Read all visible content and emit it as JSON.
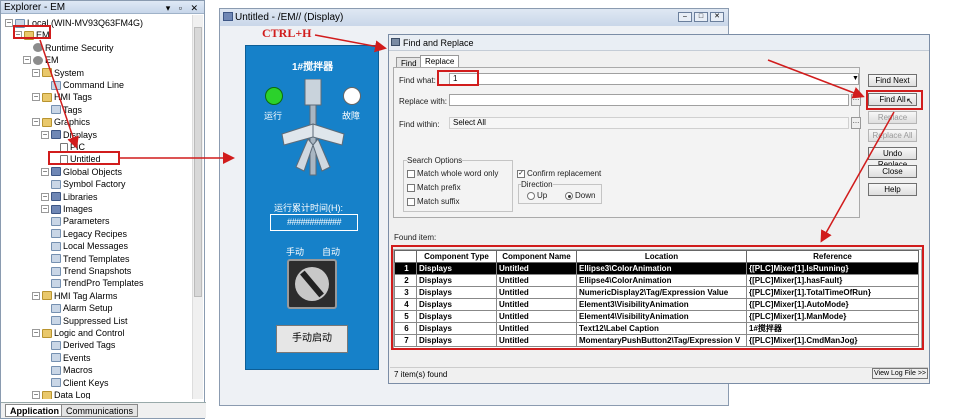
{
  "explorer": {
    "title": "Explorer - EM",
    "tree": [
      {
        "label": "Local (WIN-MV93Q63FM4G)",
        "indent": 0,
        "icon": "computer-icon"
      },
      {
        "label": "EM",
        "indent": 1,
        "icon": "folder-icon"
      },
      {
        "label": "Runtime Security",
        "indent": 2,
        "icon": "security-icon"
      },
      {
        "label": "EM",
        "indent": 2,
        "icon": "gear-icon"
      },
      {
        "label": "System",
        "indent": 3,
        "icon": "folder-icon"
      },
      {
        "label": "Command Line",
        "indent": 4,
        "icon": "component-icon"
      },
      {
        "label": "HMI Tags",
        "indent": 3,
        "icon": "folder-icon"
      },
      {
        "label": "Tags",
        "indent": 4,
        "icon": "component-icon"
      },
      {
        "label": "Graphics",
        "indent": 3,
        "icon": "folder-icon"
      },
      {
        "label": "Displays",
        "indent": 4,
        "icon": "display-icon"
      },
      {
        "label": "PIC",
        "indent": 5,
        "icon": "page-icon"
      },
      {
        "label": "Untitled",
        "indent": 5,
        "icon": "page-icon"
      },
      {
        "label": "Global Objects",
        "indent": 4,
        "icon": "display-icon"
      },
      {
        "label": "Symbol Factory",
        "indent": 4,
        "icon": "component-icon"
      },
      {
        "label": "Libraries",
        "indent": 4,
        "icon": "display-icon"
      },
      {
        "label": "Images",
        "indent": 4,
        "icon": "display-icon"
      },
      {
        "label": "Parameters",
        "indent": 4,
        "icon": "component-icon"
      },
      {
        "label": "Legacy Recipes",
        "indent": 4,
        "icon": "component-icon"
      },
      {
        "label": "Local Messages",
        "indent": 4,
        "icon": "component-icon"
      },
      {
        "label": "Trend Templates",
        "indent": 4,
        "icon": "component-icon"
      },
      {
        "label": "Trend Snapshots",
        "indent": 4,
        "icon": "component-icon"
      },
      {
        "label": "TrendPro Templates",
        "indent": 4,
        "icon": "component-icon"
      },
      {
        "label": "HMI Tag Alarms",
        "indent": 3,
        "icon": "folder-icon"
      },
      {
        "label": "Alarm Setup",
        "indent": 4,
        "icon": "component-icon"
      },
      {
        "label": "Suppressed List",
        "indent": 4,
        "icon": "component-icon"
      },
      {
        "label": "Logic and Control",
        "indent": 3,
        "icon": "folder-icon"
      },
      {
        "label": "Derived Tags",
        "indent": 4,
        "icon": "component-icon"
      },
      {
        "label": "Events",
        "indent": 4,
        "icon": "component-icon"
      },
      {
        "label": "Macros",
        "indent": 4,
        "icon": "component-icon"
      },
      {
        "label": "Client Keys",
        "indent": 4,
        "icon": "component-icon"
      },
      {
        "label": "Data Log",
        "indent": 3,
        "icon": "folder-icon"
      }
    ],
    "tabs": [
      "Application",
      "Communications"
    ]
  },
  "display_window": {
    "title": "Untitled - /EM// (Display)",
    "hmi": {
      "title": "1#搅拌器",
      "label_run": "运行",
      "label_fault": "故障",
      "runtime_label": "运行累计时间(H):",
      "runtime_value": "############",
      "label_manual": "手动",
      "label_auto": "自动",
      "start_button": "手动启动"
    }
  },
  "annotation": {
    "shortcut": "CTRL+H"
  },
  "find_replace": {
    "title": "Find and Replace",
    "tabs": [
      "Find",
      "Replace"
    ],
    "find_what_label": "Find what:",
    "find_what_value": "1",
    "replace_with_label": "Replace with:",
    "replace_with_value": "",
    "find_within_label": "Find within:",
    "find_within_value": "Select All",
    "search_options_label": "Search Options",
    "match_whole_word": "Match whole word only",
    "match_prefix": "Match prefix",
    "match_suffix": "Match suffix",
    "confirm_replacement": "Confirm replacement",
    "direction_label": "Direction",
    "dir_up": "Up",
    "dir_down": "Down",
    "buttons": {
      "find_next": "Find Next",
      "find_all": "Find All",
      "replace": "Replace",
      "replace_all": "Replace All",
      "undo_replace": "Undo Replace",
      "close": "Close",
      "help": "Help"
    },
    "found_items_label": "Found item:",
    "columns": [
      "",
      "Component Type",
      "Component  Name",
      "Location",
      "Reference"
    ],
    "rows": [
      [
        "1",
        "Displays",
        "Untitled",
        "Ellipse3\\ColorAnimation",
        "{[PLC]Mixer[1].IsRunning}"
      ],
      [
        "2",
        "Displays",
        "Untitled",
        "Ellipse4\\ColorAnimation",
        "{[PLC]Mixer[1].hasFault}"
      ],
      [
        "3",
        "Displays",
        "Untitled",
        "NumericDisplay2\\Tag/Expression Value",
        "{[PLC]Mixer[1].TotalTimeOfRun}"
      ],
      [
        "4",
        "Displays",
        "Untitled",
        "Element3\\VisibilityAnimation",
        "{[PLC]Mixer[1].AutoMode}"
      ],
      [
        "5",
        "Displays",
        "Untitled",
        "Element4\\VisibilityAnimation",
        "{[PLC]Mixer[1].ManMode}"
      ],
      [
        "6",
        "Displays",
        "Untitled",
        "Text12\\Label Caption",
        "1#搅拌器"
      ],
      [
        "7",
        "Displays",
        "Untitled",
        "MomentaryPushButton2\\Tag/Expression V",
        "{[PLC]Mixer[1].CmdManJog}"
      ]
    ],
    "status": "7 item(s) found",
    "view_log": "View Log File >>"
  }
}
